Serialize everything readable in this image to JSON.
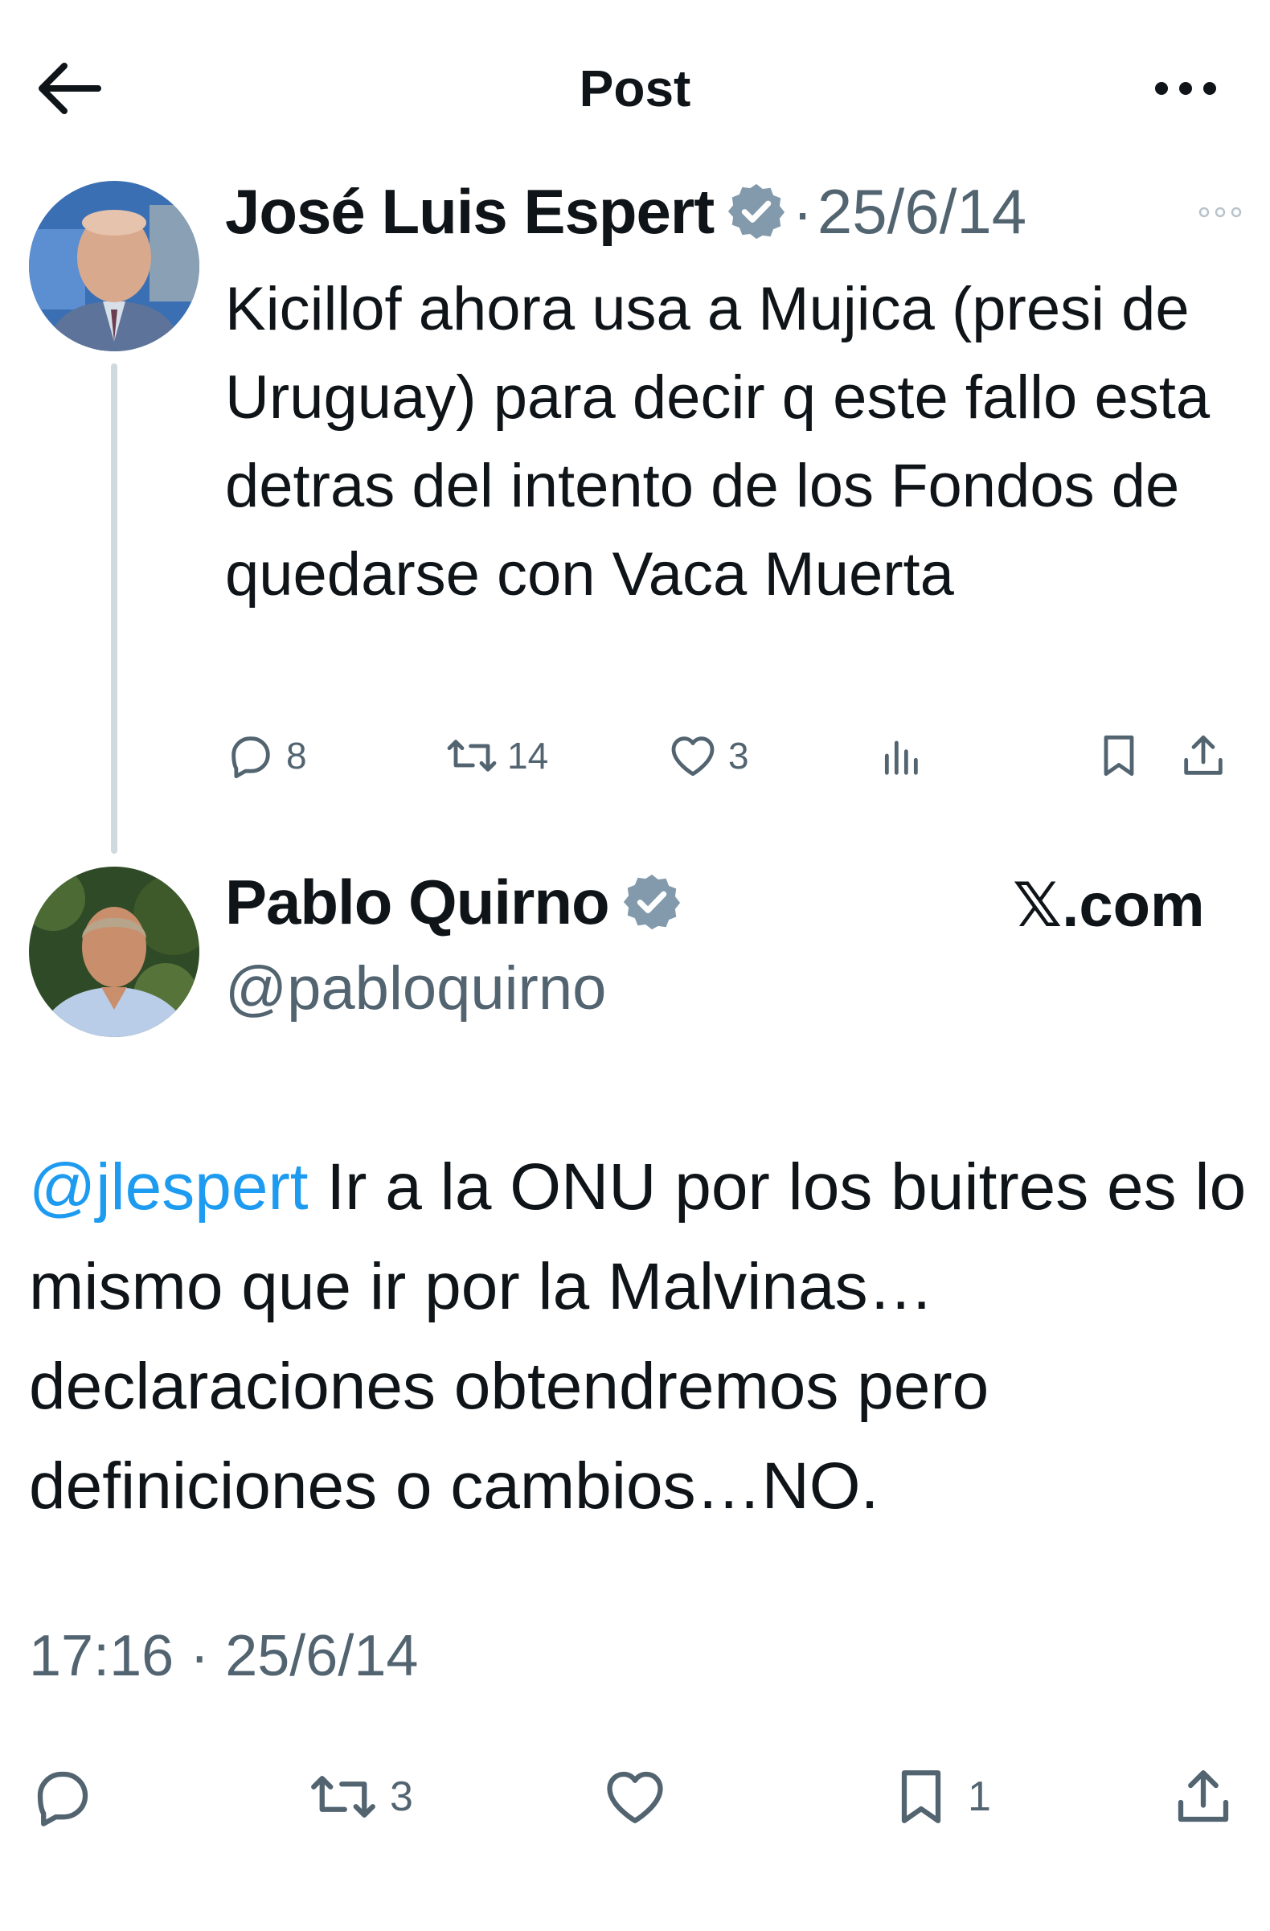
{
  "header": {
    "title": "Post"
  },
  "parent_tweet": {
    "author_name": "José Luis Espert",
    "separator": "·",
    "date": "25/6/14",
    "text": "Kicillof ahora usa a Mujica (presi de Uruguay) para decir q este fallo esta detras del intento de los Fondos de quedarse con Vaca Muerta",
    "replies": "8",
    "retweets": "14",
    "likes": "3"
  },
  "reply_tweet": {
    "author_name": "Pablo Quirno",
    "handle": "@pabloquirno",
    "watermark": "𝕏.com",
    "mention": "@jlespert",
    "text": " Ir a la ONU por los buitres es lo mismo que ir por la Malvinas… declaraciones obtendremos pero definiciones o cambios…NO.",
    "time": "17:16",
    "separator": "·",
    "date": "25/6/14",
    "retweets": "3",
    "bookmarks": "1"
  },
  "colors": {
    "verified": "#829aab",
    "link": "#1d9bf0",
    "muted": "#536471",
    "text": "#0f1419"
  },
  "icons": [
    "back-arrow-icon",
    "more-icon",
    "verified-icon",
    "caret-icon",
    "reply-icon",
    "retweet-icon",
    "like-icon",
    "views-icon",
    "bookmark-icon",
    "share-icon"
  ]
}
